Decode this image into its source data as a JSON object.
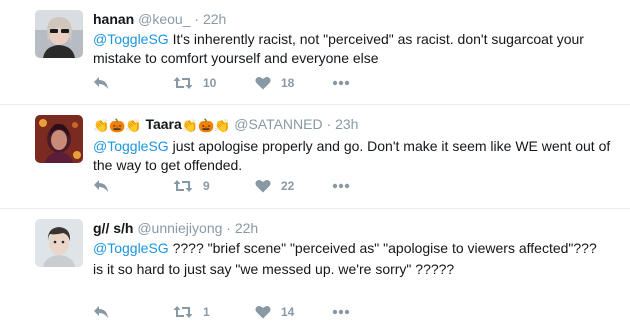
{
  "tweets": [
    {
      "name": "hanan",
      "handle": "@keou_",
      "time": "22h",
      "mention": "@ToggleSG",
      "text": " It's inherently racist, not \"perceived\" as racist. don't sugarcoat your mistake to comfort yourself and everyone else",
      "retweets": "10",
      "likes": "18"
    },
    {
      "name": "Taara",
      "handle": "@SATANNED",
      "time": "23h",
      "mention": "@ToggleSG",
      "text": " just apologise properly and go. Don't make it seem like WE went out of the way to get offended.",
      "retweets": "9",
      "likes": "22"
    },
    {
      "name": "g// s/h",
      "handle": "@unniejiyong",
      "time": "22h",
      "mention": "@ToggleSG",
      "text": " ???? \"brief scene\" \"perceived as\" \"apologise to viewers affected\"???",
      "text2": "is it so hard to just say \"we messed up. we're sorry\" ?????",
      "retweets": "1",
      "likes": "14"
    }
  ],
  "separator": "·",
  "icons": {
    "reply": "reply-icon",
    "retweet": "retweet-icon",
    "like": "heart-icon",
    "more": "more-icon",
    "emoji": [
      "clapping-hands-emoji",
      "jack-o-lantern-emoji"
    ]
  },
  "colors": {
    "link": "#1b95e0",
    "muted": "#8899a6",
    "text": "#14171a",
    "divider": "#e6ecf0"
  }
}
